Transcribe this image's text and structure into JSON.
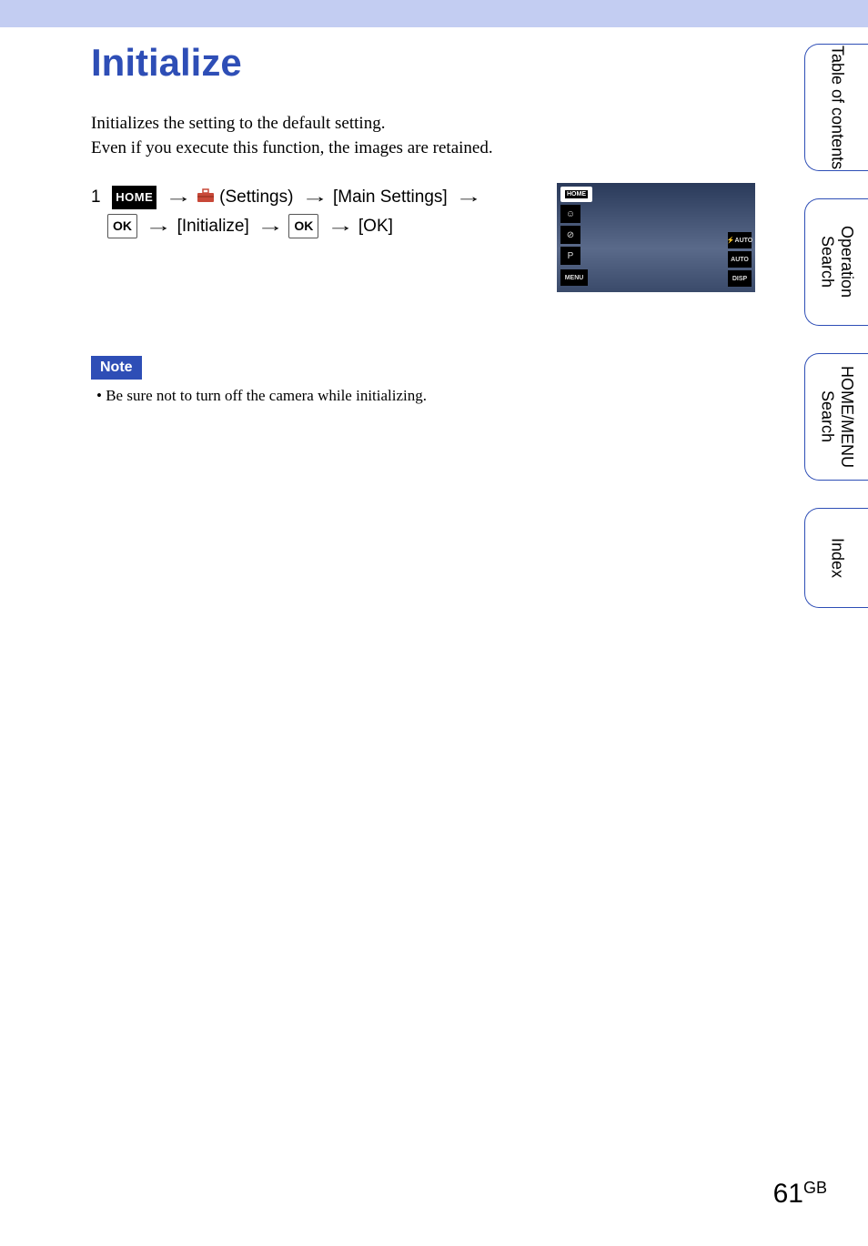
{
  "title": "Initialize",
  "intro": {
    "line1": "Initializes the setting to the default setting.",
    "line2": "Even if you execute this function, the images are retained."
  },
  "step": {
    "number": "1",
    "home_label": "HOME",
    "settings_word": "(Settings)",
    "main_settings": "[Main Settings]",
    "ok_label": "OK",
    "initialize": "[Initialize]",
    "ok_final": "[OK]"
  },
  "screenshot": {
    "left_home": "HOME",
    "left_smiley": "☺",
    "left_off": "⊘",
    "left_pauto": "P",
    "left_menu": "MENU",
    "right_flash": "⚡AUTO",
    "right_macro": "AUTO",
    "right_disp": "DISP"
  },
  "note": {
    "label": "Note",
    "bullet": "• Be sure not to turn off the camera while initializing."
  },
  "side_tabs": {
    "tab1": "Table of\ncontents",
    "tab2": "Operation\nSearch",
    "tab3": "HOME/MENU\nSearch",
    "tab4": "Index"
  },
  "page": {
    "number": "61",
    "suffix": "GB"
  }
}
